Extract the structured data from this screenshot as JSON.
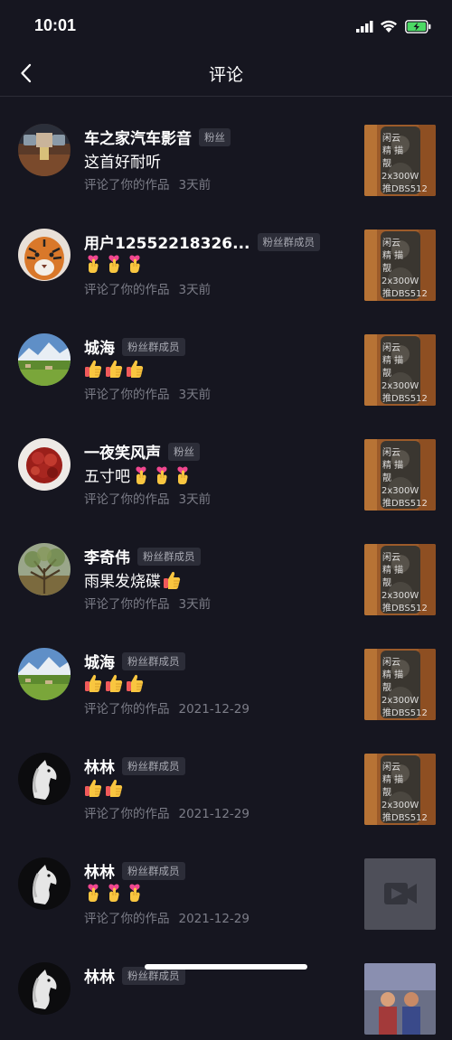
{
  "status": {
    "time": "10:01"
  },
  "header": {
    "title": "评论"
  },
  "colors": {
    "background": "#161620",
    "badge_bg": "#2c2d38",
    "meta_text": "#7c7d88"
  },
  "items": [
    {
      "name": "车之家汽车影音",
      "badge": "粉丝",
      "comment": "这首好耐听",
      "emojis": [],
      "action": "评论了你的作品",
      "time": "3天前",
      "avatar": "stage",
      "thumb": "speaker"
    },
    {
      "name": "用户12552218326...",
      "badge": "粉丝群成员",
      "comment": "",
      "emojis": [
        "crossed-fingers-icon",
        "crossed-fingers-icon",
        "crossed-fingers-icon"
      ],
      "action": "评论了你的作品",
      "time": "3天前",
      "avatar": "tiger",
      "thumb": "speaker"
    },
    {
      "name": "城海",
      "badge": "粉丝群成员",
      "comment": "",
      "emojis": [
        "thumbs-up-icon",
        "thumbs-up-icon",
        "thumbs-up-icon"
      ],
      "action": "评论了你的作品",
      "time": "3天前",
      "avatar": "landscape",
      "thumb": "speaker"
    },
    {
      "name": "一夜笑风声",
      "badge": "粉丝",
      "comment": "五寸吧",
      "emojis": [
        "crossed-fingers-icon",
        "crossed-fingers-icon",
        "crossed-fingers-icon"
      ],
      "action": "评论了你的作品",
      "time": "3天前",
      "avatar": "flower",
      "thumb": "speaker"
    },
    {
      "name": "李奇伟",
      "badge": "粉丝群成员",
      "comment": "雨果发烧碟",
      "emojis": [
        "thumbs-up-icon"
      ],
      "action": "评论了你的作品",
      "time": "3天前",
      "avatar": "tree",
      "thumb": "speaker"
    },
    {
      "name": "城海",
      "badge": "粉丝群成员",
      "comment": "",
      "emojis": [
        "thumbs-up-icon",
        "thumbs-up-icon",
        "thumbs-up-icon"
      ],
      "action": "评论了你的作品",
      "time": "2021-12-29",
      "avatar": "landscape",
      "thumb": "speaker"
    },
    {
      "name": "林林",
      "badge": "粉丝群成员",
      "comment": "",
      "emojis": [
        "thumbs-up-icon",
        "thumbs-up-icon"
      ],
      "action": "评论了你的作品",
      "time": "2021-12-29",
      "avatar": "horse",
      "thumb": "speaker"
    },
    {
      "name": "林林",
      "badge": "粉丝群成员",
      "comment": "",
      "emojis": [
        "crossed-fingers-icon",
        "crossed-fingers-icon",
        "crossed-fingers-icon"
      ],
      "action": "评论了你的作品",
      "time": "2021-12-29",
      "avatar": "horse",
      "thumb": "video-placeholder"
    },
    {
      "name": "林林",
      "badge": "粉丝群成员",
      "comment": "",
      "emojis": [],
      "action": "",
      "time": "",
      "avatar": "horse",
      "thumb": "people"
    }
  ]
}
